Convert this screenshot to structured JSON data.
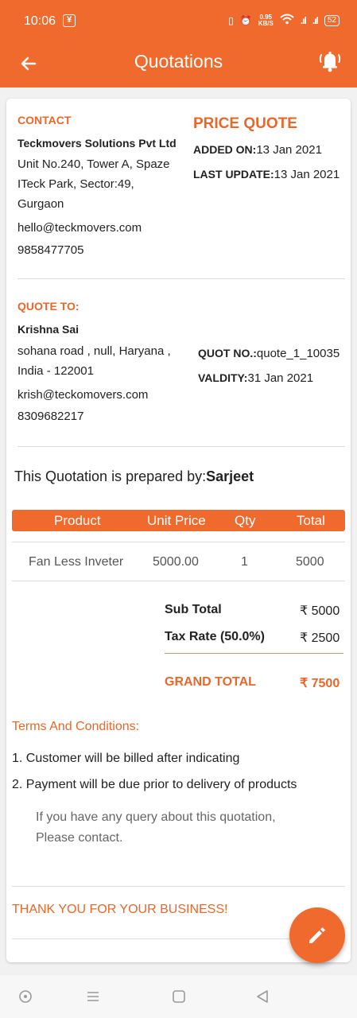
{
  "status_bar": {
    "time": "10:06",
    "speed_value": "0.95",
    "speed_unit": "KB/S",
    "battery": "52"
  },
  "appbar": {
    "title": "Quotations",
    "back_icon": "arrow-left-icon",
    "bell_icon": "bell-ring-icon"
  },
  "contact": {
    "label": "CONTACT",
    "company": "Teckmovers Solutions Pvt Ltd",
    "address_line1": "Unit No.240, Tower A, Spaze",
    "address_line2": "ITeck Park, Sector:49,",
    "address_line3": "Gurgaon",
    "email": "hello@teckmovers.com",
    "phone": "9858477705"
  },
  "quote_header": {
    "title": "PRICE QUOTE",
    "added_label": "ADDED ON:",
    "added_value": "13 Jan 2021",
    "updated_label": "LAST UPDATE:",
    "updated_value": "13 Jan 2021"
  },
  "quote_to": {
    "label": "QUOTE TO:",
    "name": "Krishna Sai",
    "address_line1": "sohana road , null, Haryana ,",
    "address_line2": "India - 122001",
    "email": "krish@teckomovers.com",
    "phone": "8309682217",
    "quot_no_label": "QUOT NO.:",
    "quot_no_value": "quote_1_10035",
    "validity_label": "VALDITY:",
    "validity_value": "31 Jan 2021"
  },
  "prepared": {
    "text": "This Quotation is prepared by:",
    "name": "Sarjeet"
  },
  "table": {
    "headers": [
      "Product",
      "Unit Price",
      "Qty",
      "Total"
    ],
    "rows": [
      {
        "product": "Fan Less Inveter",
        "unit_price": "5000.00",
        "qty": "1",
        "total": "5000"
      }
    ]
  },
  "totals": {
    "subtotal_label": "Sub Total",
    "subtotal_value": "₹ 5000",
    "tax_label": "Tax Rate (50.0%)",
    "tax_value": "₹ 2500",
    "grand_label": "GRAND TOTAL",
    "grand_value": "₹ 7500"
  },
  "terms": {
    "title": "Terms And Conditions:",
    "items": [
      "1. Customer will be billed after indicating",
      "2. Payment will be due prior to delivery of products"
    ],
    "query_line1": "If you have any query about this quotation,",
    "query_line2": "Please contact."
  },
  "footer": {
    "thanks": "THANK YOU FOR YOUR BUSINESS!",
    "fab_icon": "pencil-icon"
  },
  "colors": {
    "accent": "#ef6a2c",
    "label_orange": "#e9672a"
  }
}
